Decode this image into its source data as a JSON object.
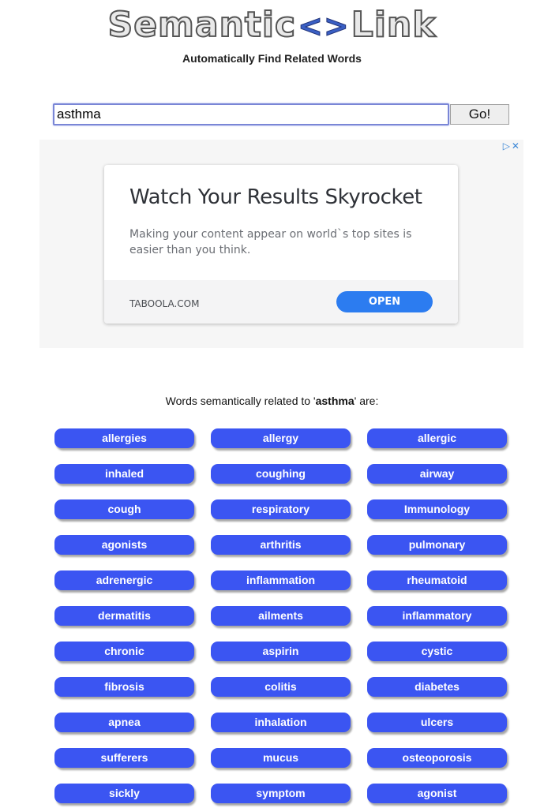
{
  "header": {
    "logo_left": "Semantic",
    "logo_middle": "<>",
    "logo_right": "Link",
    "tagline": "Automatically Find Related Words"
  },
  "search": {
    "value": "asthma",
    "go_label": "Go!"
  },
  "ad": {
    "choices_icons": "▷✕",
    "title": "Watch Your Results Skyrocket",
    "body": "Making your content appear on world`s top sites is easier than you think.",
    "source": "TABOOLA.COM",
    "open_label": "OPEN"
  },
  "results": {
    "intro_prefix": "Words semantically related to '",
    "query": "asthma",
    "intro_suffix": "' are:",
    "words": [
      "allergies",
      "allergy",
      "allergic",
      "inhaled",
      "coughing",
      "airway",
      "cough",
      "respiratory",
      "Immunology",
      "agonists",
      "arthritis",
      "pulmonary",
      "adrenergic",
      "inflammation",
      "rheumatoid",
      "dermatitis",
      "ailments",
      "inflammatory",
      "chronic",
      "aspirin",
      "cystic",
      "fibrosis",
      "colitis",
      "diabetes",
      "apnea",
      "inhalation",
      "ulcers",
      "sufferers",
      "mucus",
      "osteoporosis",
      "sickly",
      "symptom",
      "agonist"
    ]
  },
  "colors": {
    "word_button": "#3b55f2",
    "ad_open_button": "#2c7cf0",
    "logo_arrows": "#3a5fc4"
  }
}
